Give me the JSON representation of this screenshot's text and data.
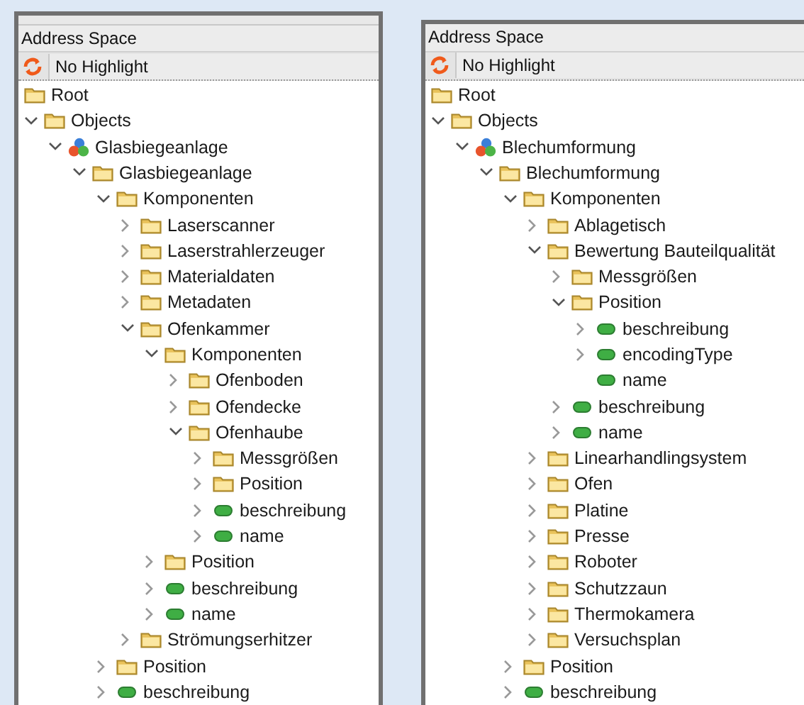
{
  "panels": [
    {
      "title": "Address Space",
      "highlight": "No Highlight",
      "tree": [
        {
          "label": "Root",
          "kind": "folder",
          "children": [
            {
              "label": "Objects",
              "kind": "folder",
              "expanded": true,
              "children": [
                {
                  "label": "Glasbiegeanlage",
                  "kind": "object",
                  "expanded": true,
                  "children": [
                    {
                      "label": "Glasbiegeanlage",
                      "kind": "folder",
                      "expanded": true,
                      "children": [
                        {
                          "label": "Komponenten",
                          "kind": "folder",
                          "expanded": true,
                          "children": [
                            {
                              "label": "Laserscanner",
                              "kind": "folder",
                              "expanded": false
                            },
                            {
                              "label": "Laserstrahlerzeuger",
                              "kind": "folder",
                              "expanded": false
                            },
                            {
                              "label": "Materialdaten",
                              "kind": "folder",
                              "expanded": false
                            },
                            {
                              "label": "Metadaten",
                              "kind": "folder",
                              "expanded": false
                            },
                            {
                              "label": "Ofenkammer",
                              "kind": "folder",
                              "expanded": true,
                              "children": [
                                {
                                  "label": "Komponenten",
                                  "kind": "folder",
                                  "expanded": true,
                                  "children": [
                                    {
                                      "label": "Ofenboden",
                                      "kind": "folder",
                                      "expanded": false
                                    },
                                    {
                                      "label": "Ofendecke",
                                      "kind": "folder",
                                      "expanded": false
                                    },
                                    {
                                      "label": "Ofenhaube",
                                      "kind": "folder",
                                      "expanded": true,
                                      "children": [
                                        {
                                          "label": "Messgrößen",
                                          "kind": "folder",
                                          "expanded": false
                                        },
                                        {
                                          "label": "Position",
                                          "kind": "folder",
                                          "expanded": false
                                        },
                                        {
                                          "label": "beschreibung",
                                          "kind": "variable",
                                          "expanded": false
                                        },
                                        {
                                          "label": "name",
                                          "kind": "variable",
                                          "expanded": false
                                        }
                                      ]
                                    }
                                  ]
                                },
                                {
                                  "label": "Position",
                                  "kind": "folder",
                                  "expanded": false
                                },
                                {
                                  "label": "beschreibung",
                                  "kind": "variable",
                                  "expanded": false
                                },
                                {
                                  "label": "name",
                                  "kind": "variable",
                                  "expanded": false
                                }
                              ]
                            },
                            {
                              "label": "Strömungserhitzer",
                              "kind": "folder",
                              "expanded": false
                            }
                          ]
                        },
                        {
                          "label": "Position",
                          "kind": "folder",
                          "expanded": false
                        },
                        {
                          "label": "beschreibung",
                          "kind": "variable",
                          "expanded": false
                        }
                      ]
                    }
                  ]
                }
              ]
            }
          ]
        }
      ]
    },
    {
      "title": "Address Space",
      "highlight": "No Highlight",
      "tree": [
        {
          "label": "Root",
          "kind": "folder",
          "children": [
            {
              "label": "Objects",
              "kind": "folder",
              "expanded": true,
              "children": [
                {
                  "label": "Blechumformung",
                  "kind": "object",
                  "expanded": true,
                  "children": [
                    {
                      "label": "Blechumformung",
                      "kind": "folder",
                      "expanded": true,
                      "children": [
                        {
                          "label": "Komponenten",
                          "kind": "folder",
                          "expanded": true,
                          "children": [
                            {
                              "label": "Ablagetisch",
                              "kind": "folder",
                              "expanded": false
                            },
                            {
                              "label": "Bewertung Bauteilqualität",
                              "kind": "folder",
                              "expanded": true,
                              "children": [
                                {
                                  "label": "Messgrößen",
                                  "kind": "folder",
                                  "expanded": false
                                },
                                {
                                  "label": "Position",
                                  "kind": "folder",
                                  "expanded": true,
                                  "children": [
                                    {
                                      "label": "beschreibung",
                                      "kind": "variable",
                                      "expanded": false
                                    },
                                    {
                                      "label": "encodingType",
                                      "kind": "variable",
                                      "expanded": false
                                    },
                                    {
                                      "label": "name",
                                      "kind": "variable"
                                    }
                                  ]
                                },
                                {
                                  "label": "beschreibung",
                                  "kind": "variable",
                                  "expanded": false
                                },
                                {
                                  "label": "name",
                                  "kind": "variable",
                                  "expanded": false
                                }
                              ]
                            },
                            {
                              "label": "Linearhandlingsystem",
                              "kind": "folder",
                              "expanded": false
                            },
                            {
                              "label": "Ofen",
                              "kind": "folder",
                              "expanded": false
                            },
                            {
                              "label": "Platine",
                              "kind": "folder",
                              "expanded": false
                            },
                            {
                              "label": "Presse",
                              "kind": "folder",
                              "expanded": false
                            },
                            {
                              "label": "Roboter",
                              "kind": "folder",
                              "expanded": false
                            },
                            {
                              "label": "Schutzzaun",
                              "kind": "folder",
                              "expanded": false
                            },
                            {
                              "label": "Thermokamera",
                              "kind": "folder",
                              "expanded": false
                            },
                            {
                              "label": "Versuchsplan",
                              "kind": "folder",
                              "expanded": false
                            }
                          ]
                        },
                        {
                          "label": "Position",
                          "kind": "folder",
                          "expanded": false
                        },
                        {
                          "label": "beschreibung",
                          "kind": "variable",
                          "expanded": false
                        }
                      ]
                    }
                  ]
                }
              ]
            }
          ]
        }
      ]
    }
  ]
}
